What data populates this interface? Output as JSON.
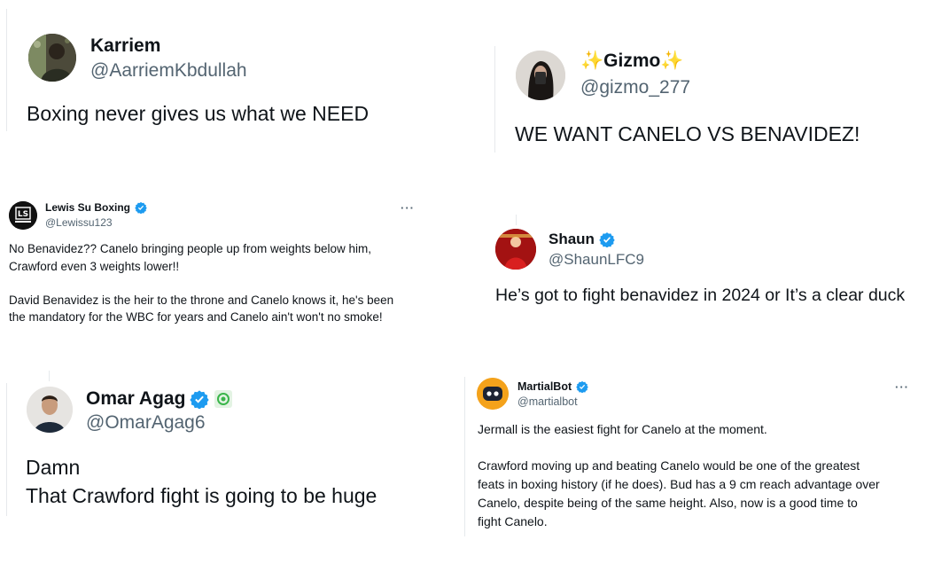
{
  "tweets": [
    {
      "name": "Karriem",
      "handle": "@AarriemKbdullah",
      "lines": [
        "Boxing never gives us what we NEED"
      ],
      "verified": false,
      "avatar_icon": "person-in-camo-avatar"
    },
    {
      "name_prefix": "✨",
      "name": "Gizmo",
      "name_suffix": "✨",
      "handle": "@gizmo_277",
      "lines": [
        "WE WANT CANELO VS BENAVIDEZ!"
      ],
      "verified": false,
      "avatar_icon": "mirror-selfie-avatar"
    },
    {
      "name": "Lewis Su Boxing",
      "handle": "@Lewissu123",
      "more": "···",
      "lines": [
        "No Benavidez?? Canelo bringing people up from weights below him,",
        "Crawford even 3 weights lower!!",
        "",
        "David Benavidez is the heir to the throne and Canelo knows it, he's been",
        "the mandatory for the WBC for years and Canelo ain't won't no smoke!"
      ],
      "verified": true,
      "avatar_text": "LS",
      "avatar_icon": "ls-logo-avatar"
    },
    {
      "name": "Shaun",
      "handle": "@ShaunLFC9",
      "lines": [
        "He’s got to fight benavidez in 2024 or It’s a clear duck"
      ],
      "verified": true,
      "avatar_icon": "red-crowd-avatar"
    },
    {
      "name": "Omar Agag",
      "handle": "@OmarAgag6",
      "lines": [
        "Damn",
        "That Crawford fight is going to be huge"
      ],
      "verified": true,
      "avatar_icon": "man-portrait-avatar"
    },
    {
      "name": "MartialBot",
      "handle": "@martialbot",
      "more": "···",
      "lines": [
        "Jermall is the easiest fight for Canelo at the moment.",
        "",
        "Crawford moving up and beating Canelo would be one of the greatest",
        "feats in boxing history (if he does). Bud has a 9 cm reach advantage over",
        "Canelo, despite being of the same height. Also, now is a good time to",
        "fight Canelo."
      ],
      "verified": true,
      "avatar_icon": "robot-avatar"
    }
  ],
  "colors": {
    "verified_blue": "#1d9bf0",
    "handle_gray": "#536471",
    "text": "#0f1419",
    "affiliate_green": "#3ab54a"
  }
}
